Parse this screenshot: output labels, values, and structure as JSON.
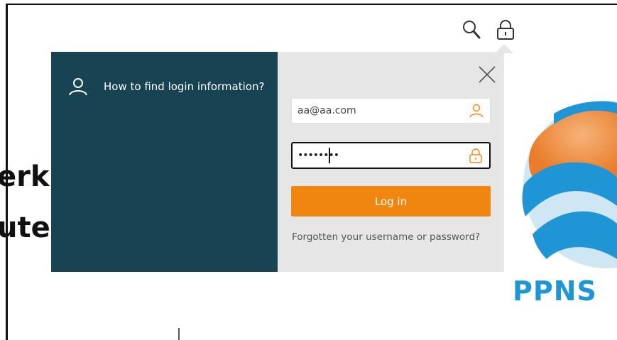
{
  "background": {
    "line1": "erk",
    "line2": "ute"
  },
  "header": {
    "search_icon": "search-icon",
    "lock_icon": "lock-icon"
  },
  "dialog": {
    "help_label": "How to find login information?",
    "username_value": "aa@aa.com",
    "password_value": "••••••••",
    "login_label": "Log in",
    "forgot_label": "Forgotten your username or password?"
  },
  "logo": {
    "text": "PPNS"
  },
  "colors": {
    "left_panel": "#174353",
    "right_panel": "#e6e6e6",
    "accent": "#f0860f",
    "logo_blue": "#1f95d6"
  }
}
